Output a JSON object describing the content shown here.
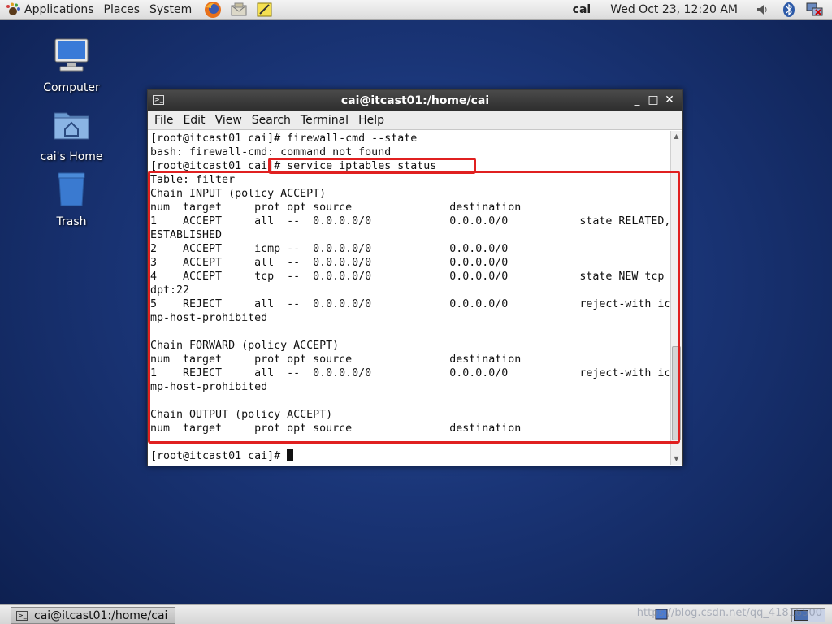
{
  "top_panel": {
    "applications": "Applications",
    "places": "Places",
    "system": "System",
    "user": "cai",
    "clock": "Wed Oct 23, 12:20 AM"
  },
  "desktop": {
    "computer": "Computer",
    "home": "cai's Home",
    "trash": "Trash"
  },
  "window": {
    "title": "cai@itcast01:/home/cai",
    "menu": [
      "File",
      "Edit",
      "View",
      "Search",
      "Terminal",
      "Help"
    ]
  },
  "terminal": {
    "lines": [
      "[root@itcast01 cai]# firewall-cmd --state",
      "bash: firewall-cmd: command not found",
      "[root@itcast01 cai]# service iptables status",
      "Table: filter",
      "Chain INPUT (policy ACCEPT)",
      "num  target     prot opt source               destination",
      "1    ACCEPT     all  --  0.0.0.0/0            0.0.0.0/0           state RELATED,",
      "ESTABLISHED",
      "2    ACCEPT     icmp --  0.0.0.0/0            0.0.0.0/0",
      "3    ACCEPT     all  --  0.0.0.0/0            0.0.0.0/0",
      "4    ACCEPT     tcp  --  0.0.0.0/0            0.0.0.0/0           state NEW tcp",
      "dpt:22",
      "5    REJECT     all  --  0.0.0.0/0            0.0.0.0/0           reject-with ic",
      "mp-host-prohibited",
      "",
      "Chain FORWARD (policy ACCEPT)",
      "num  target     prot opt source               destination",
      "1    REJECT     all  --  0.0.0.0/0            0.0.0.0/0           reject-with ic",
      "mp-host-prohibited",
      "",
      "Chain OUTPUT (policy ACCEPT)",
      "num  target     prot opt source               destination",
      "",
      "[root@itcast01 cai]# "
    ]
  },
  "taskbar": {
    "task": "cai@itcast01:/home/cai",
    "watermark": "https://blog.csdn.net/qq_41816500"
  },
  "colors": {
    "annotation": "#e02020",
    "desktop_bg": "#1a3577"
  }
}
